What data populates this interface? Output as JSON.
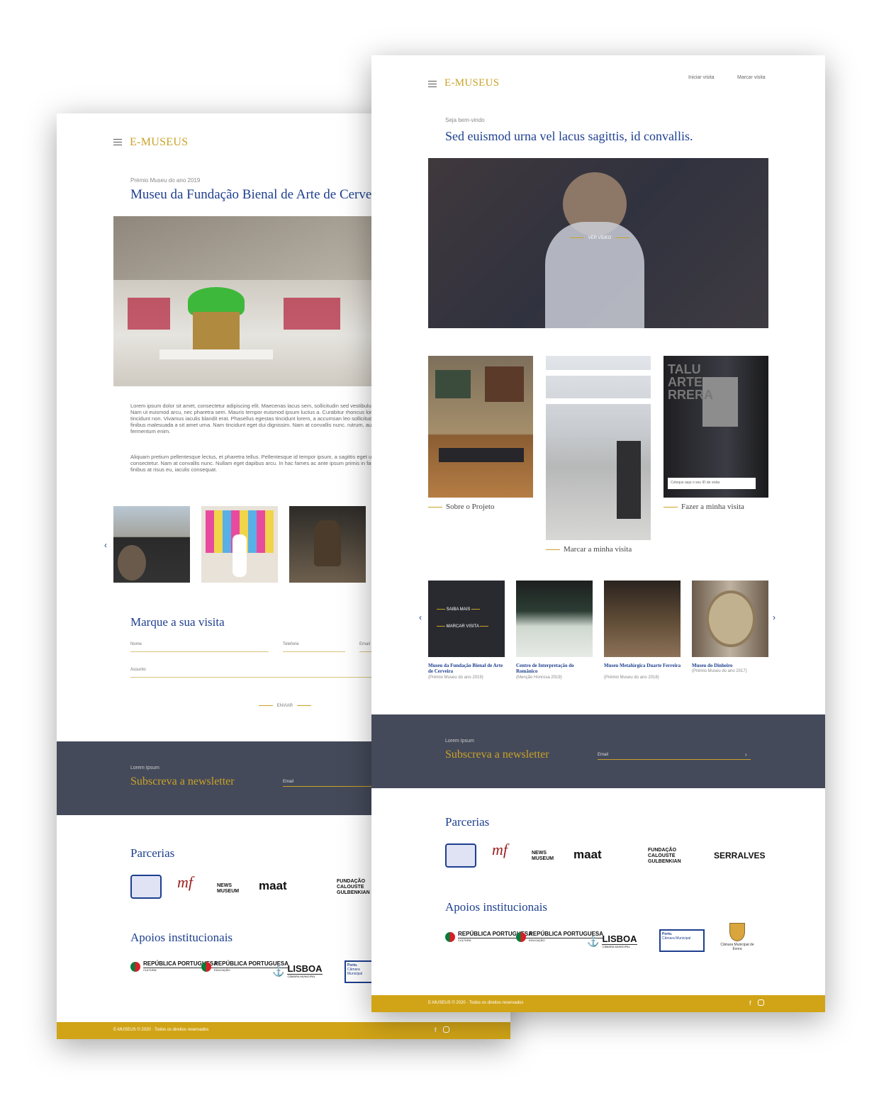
{
  "pageA": {
    "logo": "E-MUSEUS",
    "award": "Prémio Museu do ano 2019",
    "title": "Museu da Fundação Bienal de Arte de Cerveira",
    "para1": "Lorem ipsum dolor sit amet, consectetur adipiscing elit. Maecenas lacus sem, sollicitudin sed vestibulum nibh. Aliquam erat volutpat. Nam ut euismod arcu, nec pharetra sem. Mauris tempor euismod ipsum luctus a. Curabitur rhoncus lorem lacus, et ultrices odio tincidunt non. Vivamus iaculis blandit erat. Phasellus egestas tincidunt lorem, a accumsan leo sollicitudin rhoncus. Integer ante finibus malesuada a sit amet urna. Nam tincidunt eget dui dignissim. Nam at convallis nunc. rutrum, auctor magna gravida, fermentum enim.",
    "para2": "Aliquam pretium pellentesque lectus, et pharetra tellus. Pellentesque id tempor ipsum, a sagittis eget urna sed ante volutpat consectetur. Nam at convallis nunc. Nullam eget dapibus arcu. In hac fames ac ante ipsum primis in faucibus. Proin nisi tellus, finibus at risus eu, iaculis consequat.",
    "form_title": "Marque a sua visita",
    "fields": {
      "name": "Nome",
      "phone": "Telefone",
      "email": "Email",
      "subject": "Assunto"
    },
    "send": "ENVIAR",
    "news_kicker": "Lorem Ipsum",
    "news_title": "Subscreva a newsletter",
    "news_email": "Email",
    "partners_title": "Parcerias",
    "partners": [
      "maat",
      "NEWS MUSEUM",
      "FUNDAÇÃO CALOUSTE GULBENKIAN"
    ],
    "support_title": "Apoios institucionais",
    "supports": [
      {
        "name": "REPÚBLICA PORTUGUESA",
        "sub": "CULTURA"
      },
      {
        "name": "REPÚBLICA PORTUGUESA",
        "sub": "EDUCAÇÃO"
      },
      {
        "name": "LISBOA",
        "sub": "CÂMARA MUNICIPAL"
      },
      {
        "name": "Porto.",
        "sub": "Câmara Municipal"
      }
    ],
    "footer": "E-MUSEUS © 2020  ·  Todos os direitos reservados"
  },
  "pageB": {
    "logo": "E-MUSEUS",
    "nav": [
      "Iniciar visita",
      "Marcar visita"
    ],
    "welcome": "Seja bem-vindo",
    "headline": "Sed euismod urna vel lacus sagittis, id convallis.",
    "video_label": "VER VÍDEO",
    "tiles": [
      "Sobre o Projeto",
      "Marcar a minha visita",
      "Fazer a minha visita"
    ],
    "visit_id_placeholder": "Coloque aqui o seu ID de visita",
    "overlay": [
      "SAIBA MAIS",
      "MARCAR VISITA"
    ],
    "museums": [
      {
        "name": "Museu da Fundação Bienal de Arte de Cerveira",
        "award": "(Prémio Museu do ano 2019)"
      },
      {
        "name": "Centro de Interpretação do Românico",
        "award": "(Menção Honrosa 2019)"
      },
      {
        "name": "Museu Metalúrgica Duarte Ferreira",
        "award": "(Prémio Museu do ano 2018)"
      },
      {
        "name": "Museu do Dinheiro",
        "award": "(Prémio Museu do ano 2017)"
      }
    ],
    "news_kicker": "Lorem Ipsum",
    "news_title": "Subscreva a newsletter",
    "news_email": "Email",
    "partners_title": "Parcerias",
    "partners": [
      "NEWS MUSEUM",
      "maat",
      "FUNDAÇÃO CALOUSTE GULBENKIAN",
      "SERRALVES"
    ],
    "support_title": "Apoios institucionais",
    "supports": [
      {
        "name": "REPÚBLICA PORTUGUESA",
        "sub": "CULTURA"
      },
      {
        "name": "REPÚBLICA PORTUGUESA",
        "sub": "EDUCAÇÃO"
      },
      {
        "name": "LISBOA",
        "sub": "CÂMARA MUNICIPAL"
      },
      {
        "name": "Porto.",
        "sub": "Câmara Municipal"
      },
      {
        "name": "Câmara Municipal de Évora",
        "sub": ""
      }
    ],
    "footer": "E-MUSEUS © 2020  ·  Todos os direitos reservados"
  },
  "colors": {
    "gold": "#c9a227",
    "blue": "#1e3f8f",
    "band": "#454a5a",
    "footer": "#d1a417"
  }
}
